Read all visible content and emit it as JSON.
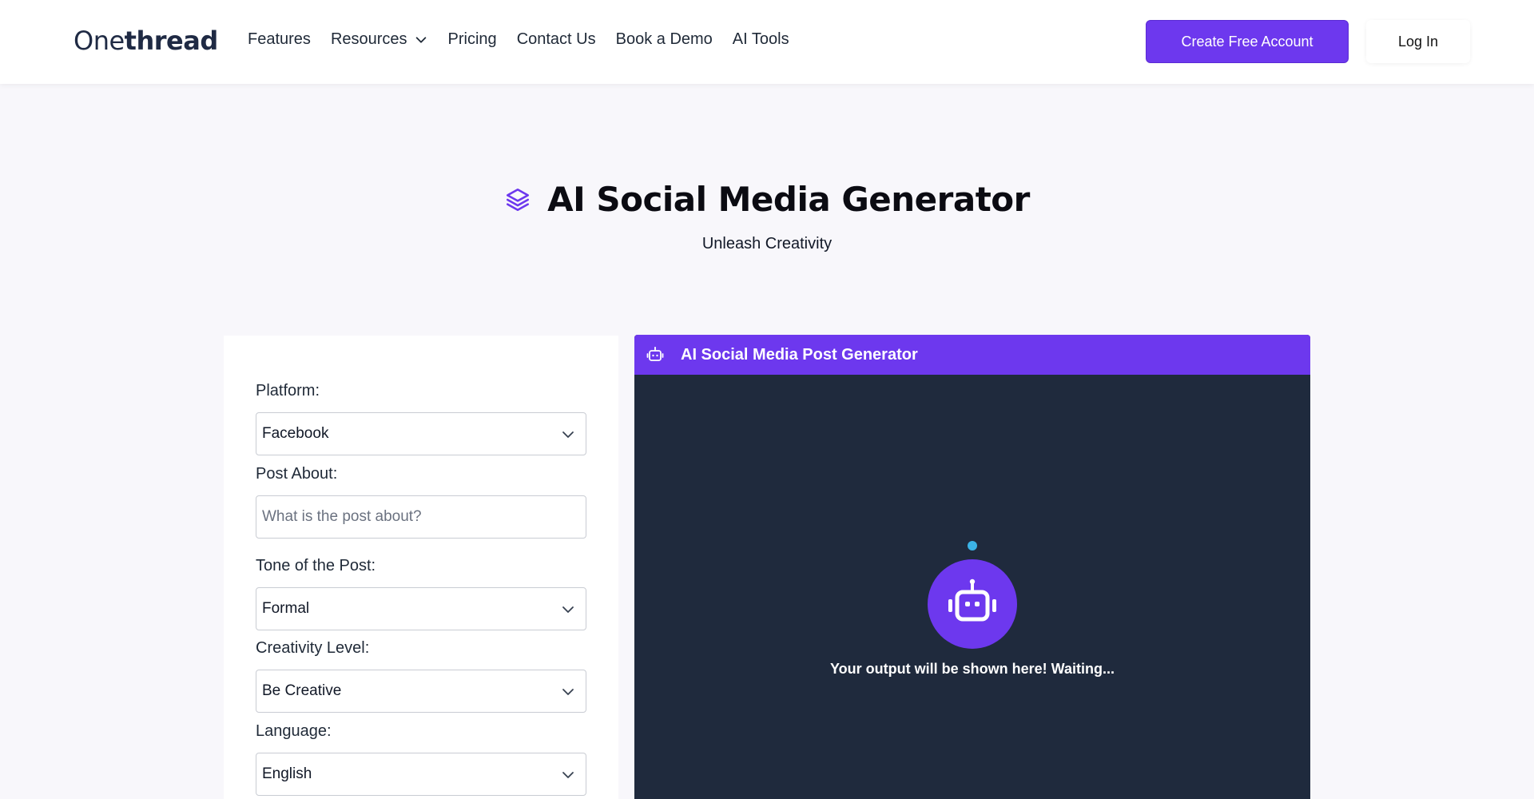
{
  "brand": {
    "logo_light": "One",
    "logo_bold": "thread"
  },
  "nav": {
    "items": [
      {
        "label": "Features"
      },
      {
        "label": "Resources"
      },
      {
        "label": "Pricing"
      },
      {
        "label": "Contact Us"
      },
      {
        "label": "Book a Demo"
      },
      {
        "label": "AI Tools"
      }
    ],
    "create_label": "Create Free Account",
    "login_label": "Log In"
  },
  "hero": {
    "title": "AI Social Media Generator",
    "subtitle": "Unleash Creativity"
  },
  "form": {
    "platform": {
      "label": "Platform:",
      "value": "Facebook"
    },
    "post_about": {
      "label": "Post About:",
      "placeholder": "What is the post about?"
    },
    "tone": {
      "label": "Tone of the Post:",
      "value": "Formal"
    },
    "creativity": {
      "label": "Creativity Level:",
      "value": "Be Creative"
    },
    "language": {
      "label": "Language:",
      "value": "English"
    }
  },
  "output": {
    "title": "AI Social Media Post Generator",
    "message": "Your output will be shown here! Waiting..."
  },
  "colors": {
    "accent": "#6d38ee",
    "output_bg": "#1f2a3d",
    "indicator": "#3bb3e6",
    "page_bg": "#f8f7fb"
  },
  "icons": {
    "hero": "layers-icon",
    "output_header": "robot-icon",
    "select": "chevron-down-icon",
    "resources": "chevron-down-icon"
  }
}
